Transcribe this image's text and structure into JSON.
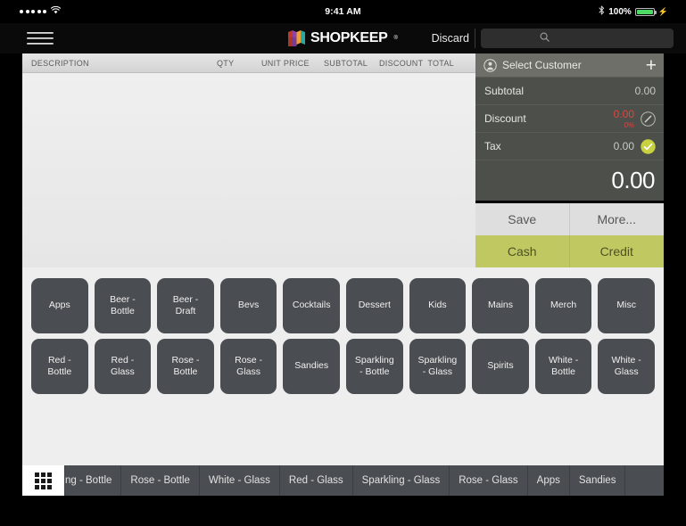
{
  "statusbar": {
    "signal_icon": "signal-dots-icon",
    "wifi_icon": "wifi-icon",
    "time": "9:41 AM",
    "bluetooth_icon": "bluetooth-icon",
    "battery_percent": "100%",
    "battery_icon": "battery-full-icon",
    "charging_icon": "charging-bolt-icon",
    "battery_color": "#4cd964"
  },
  "navbar": {
    "menu_icon": "hamburger-menu-icon",
    "brand_icon": "shopkeep-logo-icon",
    "brand_name": "SHOPKEEP",
    "brand_tm": "®",
    "discard_label": "Discard",
    "search_icon": "search-icon",
    "search_value": "",
    "search_placeholder": ""
  },
  "ticket": {
    "columns": [
      {
        "key": "description",
        "label": "DESCRIPTION"
      },
      {
        "key": "qty",
        "label": "QTY"
      },
      {
        "key": "unit_price",
        "label": "UNIT PRICE"
      },
      {
        "key": "subtotal",
        "label": "SUBTOTAL"
      },
      {
        "key": "discount",
        "label": "DISCOUNT"
      },
      {
        "key": "total",
        "label": "TOTAL"
      }
    ],
    "rows": []
  },
  "totals": {
    "customer_icon": "person-circle-icon",
    "customer_label": "Select Customer",
    "add_customer_icon": "plus-icon",
    "subtotal_label": "Subtotal",
    "subtotal_value": "0.00",
    "discount_label": "Discount",
    "discount_value": "0.00",
    "discount_percent": "0%",
    "discount_edit_icon": "pencil-circle-icon",
    "tax_label": "Tax",
    "tax_value": "0.00",
    "tax_check_icon": "check-circle-icon",
    "grand_total": "0.00",
    "accent_color": "#c0c861",
    "discount_color": "#e0443e"
  },
  "actions": {
    "save_label": "Save",
    "more_label": "More...",
    "cash_label": "Cash",
    "credit_label": "Credit"
  },
  "categories": {
    "row1": [
      "Apps",
      "Beer -\nBottle",
      "Beer -\nDraft",
      "Bevs",
      "Cocktails",
      "Dessert",
      "Kids",
      "Mains",
      "Merch",
      "Misc"
    ],
    "row2": [
      "Red -\nBottle",
      "Red -\nGlass",
      "Rose -\nBottle",
      "Rose -\nGlass",
      "Sandies",
      "Sparkling\n- Bottle",
      "Sparkling\n- Glass",
      "Spirits",
      "White -\nBottle",
      "White -\nGlass"
    ]
  },
  "tabbar": {
    "grid_icon": "grid-view-icon",
    "tabs": [
      {
        "label": "ng - Bottle",
        "clipped": true
      },
      {
        "label": "Rose - Bottle",
        "clipped": false
      },
      {
        "label": "White - Glass",
        "clipped": false
      },
      {
        "label": "Red - Glass",
        "clipped": false
      },
      {
        "label": "Sparkling - Glass",
        "clipped": false
      },
      {
        "label": "Rose - Glass",
        "clipped": false
      },
      {
        "label": "Apps",
        "clipped": false
      },
      {
        "label": "Sandies",
        "clipped": false
      }
    ]
  }
}
